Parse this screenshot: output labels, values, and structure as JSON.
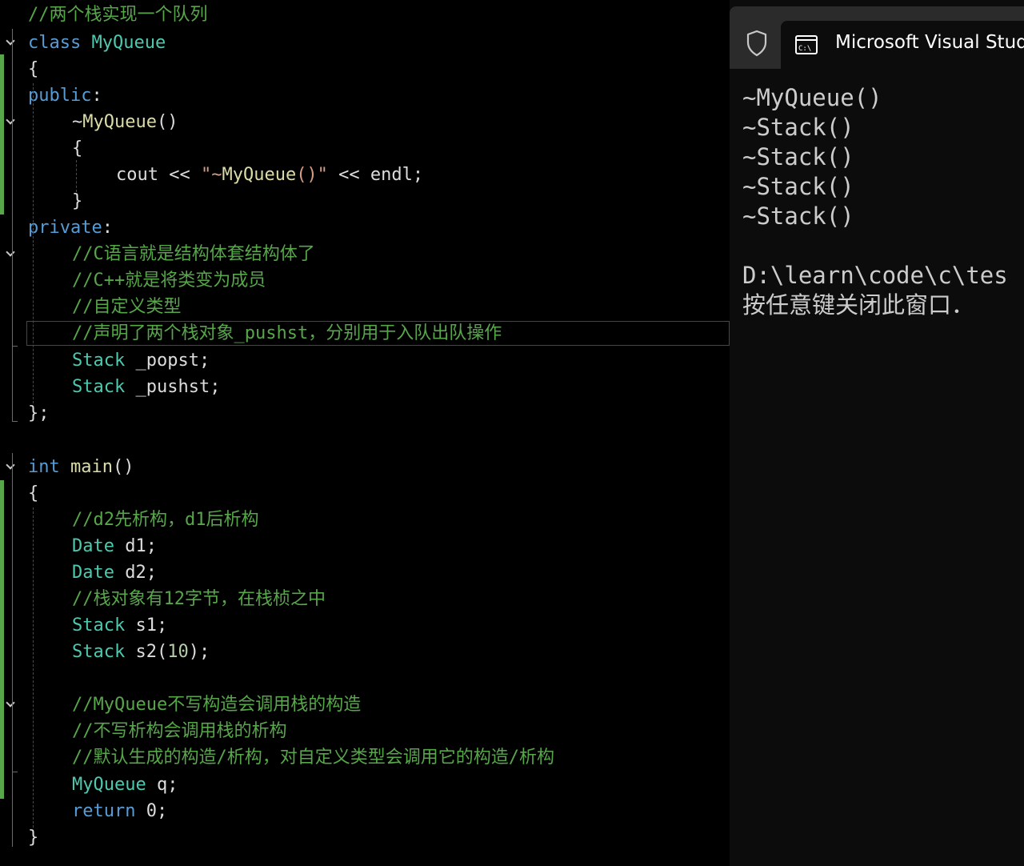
{
  "editor": {
    "lines": [
      [
        {
          "t": "//两个栈实现一个队列",
          "c": "cm"
        }
      ],
      [
        {
          "t": "class ",
          "c": "kw"
        },
        {
          "t": "MyQueue",
          "c": "ty"
        }
      ],
      [
        {
          "t": "{",
          "c": "pl"
        }
      ],
      [
        {
          "t": "public",
          "c": "kw"
        },
        {
          "t": ":",
          "c": "pl"
        }
      ],
      [
        {
          "t": "~",
          "c": "pl"
        },
        {
          "t": "MyQueue",
          "c": "fn"
        },
        {
          "t": "()",
          "c": "pl"
        }
      ],
      [
        {
          "t": "{",
          "c": "pl"
        }
      ],
      [
        {
          "t": "cout << ",
          "c": "pl"
        },
        {
          "t": "\"~",
          "c": "st"
        },
        {
          "t": "MyQueue",
          "c": "fn"
        },
        {
          "t": "()\"",
          "c": "st"
        },
        {
          "t": " << endl;",
          "c": "pl"
        }
      ],
      [
        {
          "t": "}",
          "c": "pl"
        }
      ],
      [
        {
          "t": "private",
          "c": "kw"
        },
        {
          "t": ":",
          "c": "pl"
        }
      ],
      [
        {
          "t": "//C语言就是结构体套结构体了",
          "c": "cm"
        }
      ],
      [
        {
          "t": "//C++就是将类变为成员",
          "c": "cm"
        }
      ],
      [
        {
          "t": "//自定义类型",
          "c": "cm"
        }
      ],
      [
        {
          "t": "//声明了两个栈对象_pushst，分别用于入队出队操作",
          "c": "cm"
        }
      ],
      [
        {
          "t": "Stack ",
          "c": "ty"
        },
        {
          "t": "_popst;",
          "c": "pl"
        }
      ],
      [
        {
          "t": "Stack ",
          "c": "ty"
        },
        {
          "t": "_pushst;",
          "c": "pl"
        }
      ],
      [
        {
          "t": "};",
          "c": "pl"
        }
      ],
      [],
      [
        {
          "t": "int ",
          "c": "kw"
        },
        {
          "t": "main",
          "c": "fn"
        },
        {
          "t": "()",
          "c": "pl"
        }
      ],
      [
        {
          "t": "{",
          "c": "pl"
        }
      ],
      [
        {
          "t": "//d2先析构，d1后析构",
          "c": "cm"
        }
      ],
      [
        {
          "t": "Date ",
          "c": "ty"
        },
        {
          "t": "d1;",
          "c": "pl"
        }
      ],
      [
        {
          "t": "Date ",
          "c": "ty"
        },
        {
          "t": "d2;",
          "c": "pl"
        }
      ],
      [
        {
          "t": "//栈对象有12字节，在栈桢之中",
          "c": "cm"
        }
      ],
      [
        {
          "t": "Stack ",
          "c": "ty"
        },
        {
          "t": "s1;",
          "c": "pl"
        }
      ],
      [
        {
          "t": "Stack ",
          "c": "ty"
        },
        {
          "t": "s2(",
          "c": "pl"
        },
        {
          "t": "10",
          "c": "nm"
        },
        {
          "t": ");",
          "c": "pl"
        }
      ],
      [],
      [
        {
          "t": "//MyQueue不写构造会调用栈的构造",
          "c": "cm"
        }
      ],
      [
        {
          "t": "//不写析构会调用栈的析构",
          "c": "cm"
        }
      ],
      [
        {
          "t": "//默认生成的构造/析构，对自定义类型会调用它的构造/析构",
          "c": "cm"
        }
      ],
      [
        {
          "t": "MyQueue ",
          "c": "ty"
        },
        {
          "t": "q;",
          "c": "pl"
        }
      ],
      [
        {
          "t": "return ",
          "c": "kw"
        },
        {
          "t": "0;",
          "c": "pl"
        }
      ],
      [
        {
          "t": "}",
          "c": "pl"
        }
      ]
    ]
  },
  "terminal": {
    "tab_title": "Microsoft Visual Studio",
    "shield_icon": "shield-icon",
    "cmd_icon": "cmd-prompt-icon",
    "output": [
      "~MyQueue()",
      "~Stack()",
      "~Stack()",
      "~Stack()",
      "~Stack()",
      "",
      "D:\\learn\\code\\c\\tes",
      "按任意键关闭此窗口．"
    ]
  }
}
